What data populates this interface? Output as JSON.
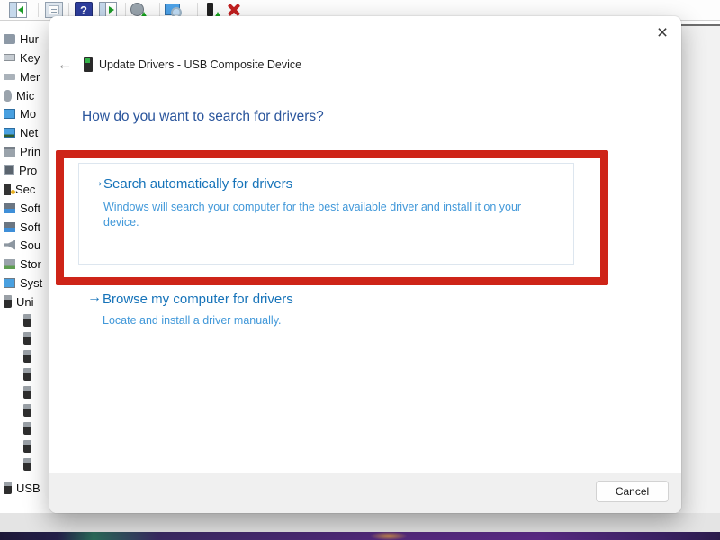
{
  "toolbar": {
    "icons": [
      {
        "name": "console-tree-icon"
      },
      {
        "name": "properties-icon"
      },
      {
        "name": "help-icon",
        "glyph": "?"
      },
      {
        "name": "action-pane-icon"
      },
      {
        "name": "update-driver-icon"
      },
      {
        "name": "scan-hardware-icon"
      },
      {
        "name": "device-update-icon"
      },
      {
        "name": "uninstall-device-icon"
      }
    ]
  },
  "device_tree": {
    "items": [
      {
        "label": "Hur",
        "icon": "hid-icon"
      },
      {
        "label": "Key",
        "icon": "keyboard-icon"
      },
      {
        "label": "Mer",
        "icon": "memory-icon"
      },
      {
        "label": "Mic",
        "icon": "mouse-icon"
      },
      {
        "label": "Mo",
        "icon": "monitor-icon"
      },
      {
        "label": "Net",
        "icon": "network-icon"
      },
      {
        "label": "Prin",
        "icon": "printer-icon"
      },
      {
        "label": "Pro",
        "icon": "processor-icon"
      },
      {
        "label": "Sec",
        "icon": "security-icon"
      },
      {
        "label": "Soft",
        "icon": "software-icon"
      },
      {
        "label": "Soft",
        "icon": "software-icon"
      },
      {
        "label": "Sou",
        "icon": "sound-icon"
      },
      {
        "label": "Stor",
        "icon": "storage-icon"
      },
      {
        "label": "Syst",
        "icon": "system-icon"
      },
      {
        "label": "Uni",
        "icon": "usb-icon"
      }
    ],
    "usb_child_count": 9,
    "bottom_item": {
      "label": "USB",
      "icon": "usb-icon"
    }
  },
  "dialog": {
    "title": "Update Drivers - USB Composite Device",
    "heading": "How do you want to search for drivers?",
    "options": [
      {
        "title": "Search automatically for drivers",
        "description": "Windows will search your computer for the best available driver and install it on your device."
      },
      {
        "title": "Browse my computer for drivers",
        "description": "Locate and install a driver manually."
      }
    ],
    "cancel_label": "Cancel"
  },
  "icons": {
    "back_glyph": "←",
    "option_arrow_glyph": "→",
    "close_glyph": "×"
  },
  "colors": {
    "heading": "#2a559c",
    "option-title": "#1673b9",
    "option-description": "#4198d9",
    "annotation": "#ce2418",
    "toolbar-red-x": "#c21f1f",
    "dialog-bg": "#ffffff",
    "footer-bg": "#f0f0f0"
  }
}
